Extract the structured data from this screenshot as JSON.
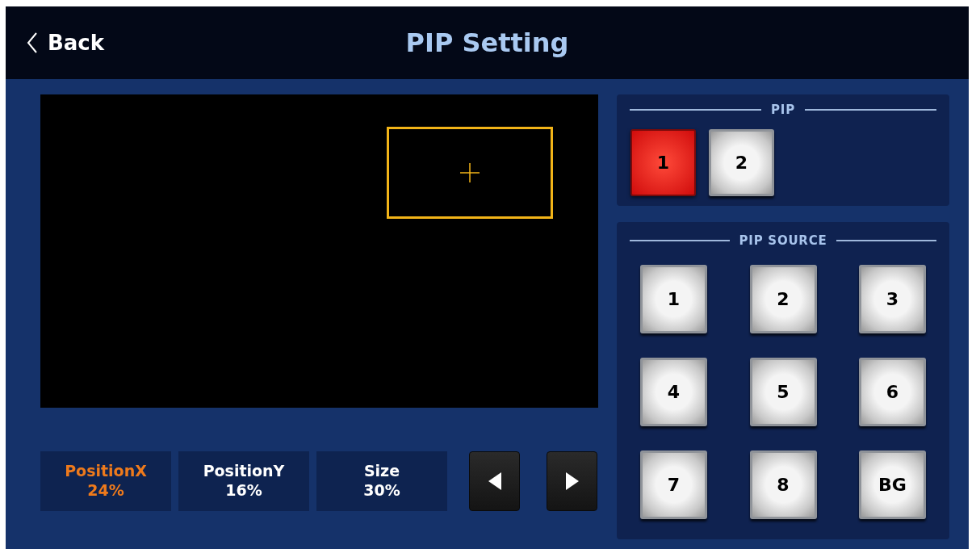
{
  "header": {
    "back": "Back",
    "title": "PIP Setting"
  },
  "preview": {
    "pip_box": true
  },
  "params": [
    {
      "label": "PositionX",
      "value": "24%",
      "selected": true
    },
    {
      "label": "PositionY",
      "value": "16%",
      "selected": false
    },
    {
      "label": "Size",
      "value": "30%",
      "selected": false
    }
  ],
  "pip": {
    "title": "PIP",
    "buttons": [
      {
        "label": "1",
        "selected": true
      },
      {
        "label": "2",
        "selected": false
      }
    ]
  },
  "pip_source": {
    "title": "PIP SOURCE",
    "buttons": [
      {
        "label": "1",
        "selected": false
      },
      {
        "label": "2",
        "selected": false
      },
      {
        "label": "3",
        "selected": false
      },
      {
        "label": "4",
        "selected": false
      },
      {
        "label": "5",
        "selected": false
      },
      {
        "label": "6",
        "selected": false
      },
      {
        "label": "7",
        "selected": false
      },
      {
        "label": "8",
        "selected": false
      },
      {
        "label": "BG",
        "selected": false
      }
    ]
  }
}
